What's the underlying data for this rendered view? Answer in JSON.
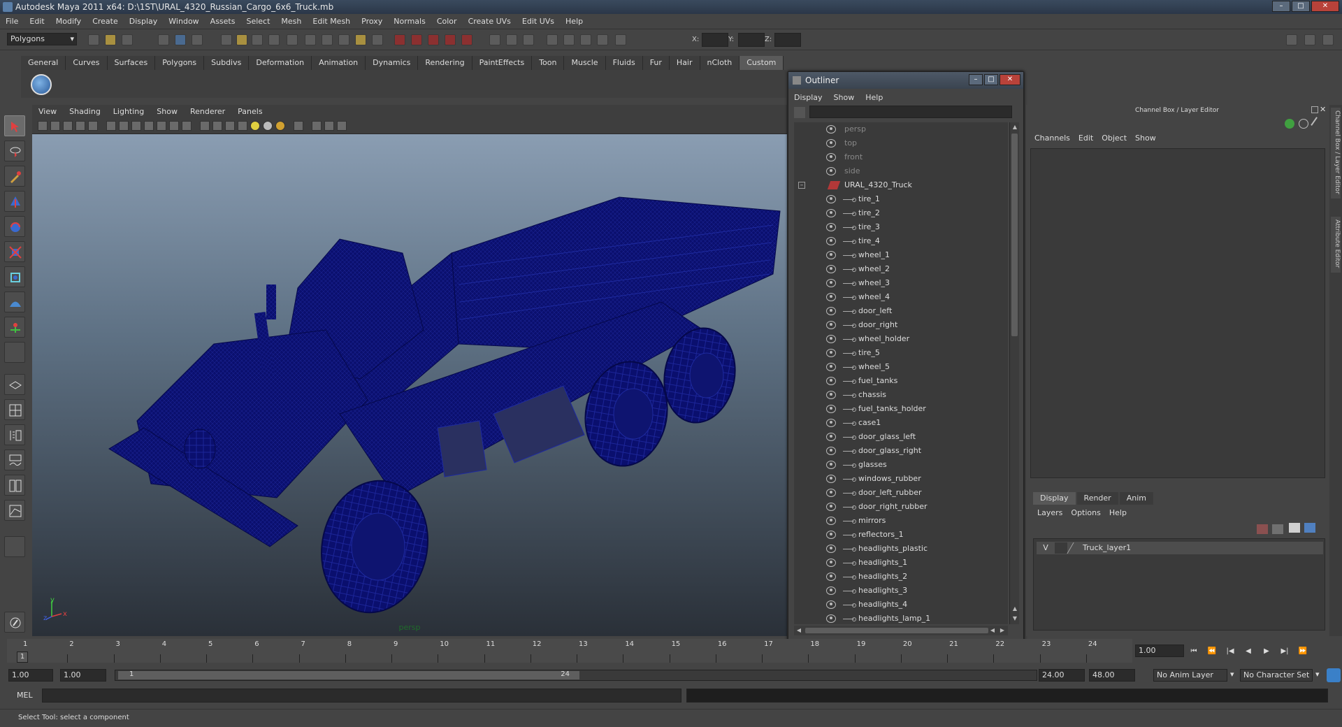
{
  "window": {
    "title": "Autodesk Maya 2011 x64: D:\\1ST\\URAL_4320_Russian_Cargo_6x6_Truck.mb",
    "minimize": "–",
    "maximize": "□",
    "close": "✕"
  },
  "menubar": [
    "File",
    "Edit",
    "Modify",
    "Create",
    "Display",
    "Window",
    "Assets",
    "Select",
    "Mesh",
    "Edit Mesh",
    "Proxy",
    "Normals",
    "Color",
    "Create UVs",
    "Edit UVs",
    "Help"
  ],
  "statusline": {
    "mode": "Polygons",
    "x_label": "X:",
    "y_label": "Y:",
    "z_label": "Z:"
  },
  "shelf": {
    "tabs": [
      "General",
      "Curves",
      "Surfaces",
      "Polygons",
      "Subdivs",
      "Deformation",
      "Animation",
      "Dynamics",
      "Rendering",
      "PaintEffects",
      "Toon",
      "Muscle",
      "Fluids",
      "Fur",
      "Hair",
      "nCloth",
      "Custom"
    ],
    "active": "Custom"
  },
  "viewport": {
    "menu": [
      "View",
      "Shading",
      "Lighting",
      "Show",
      "Renderer",
      "Panels"
    ],
    "camera": "persp",
    "axis_y": "y",
    "axis_x": "x",
    "axis_z": "z",
    "wire_color": "#0a0f6e"
  },
  "outliner": {
    "title": "Outliner",
    "menu": [
      "Display",
      "Show",
      "Help"
    ],
    "cameras": [
      "persp",
      "top",
      "front",
      "side"
    ],
    "group": "URAL_4320_Truck",
    "group_toggle": "–",
    "children": [
      "tire_1",
      "tire_2",
      "tire_3",
      "tire_4",
      "wheel_1",
      "wheel_2",
      "wheel_3",
      "wheel_4",
      "door_left",
      "door_right",
      "wheel_holder",
      "tire_5",
      "wheel_5",
      "fuel_tanks",
      "chassis",
      "fuel_tanks_holder",
      "case1",
      "door_glass_left",
      "door_glass_right",
      "glasses",
      "windows_rubber",
      "door_left_rubber",
      "door_right_rubber",
      "mirrors",
      "reflectors_1",
      "headlights_plastic",
      "headlights_1",
      "headlights_2",
      "headlights_3",
      "headlights_4",
      "headlights_lamp_1"
    ]
  },
  "channelbox": {
    "title": "Channel Box / Layer Editor",
    "menu": [
      "Channels",
      "Edit",
      "Object",
      "Show"
    ]
  },
  "layereditor": {
    "tabs": [
      "Display",
      "Render",
      "Anim"
    ],
    "active_tab": "Display",
    "menu": [
      "Layers",
      "Options",
      "Help"
    ],
    "layers": [
      {
        "visible": "V",
        "name": "Truck_layer1"
      }
    ]
  },
  "sidetabs": [
    "Channel Box / Layer Editor",
    "Attribute Editor"
  ],
  "timeslider": {
    "ticks": [
      "1",
      "2",
      "3",
      "4",
      "5",
      "6",
      "7",
      "8",
      "9",
      "10",
      "11",
      "12",
      "13",
      "14",
      "15",
      "16",
      "17",
      "18",
      "19",
      "20",
      "21",
      "22",
      "23",
      "24"
    ],
    "current": "1",
    "current_field": "1.00"
  },
  "playback": [
    "⏮",
    "⏪",
    "|◀",
    "◀",
    "▶",
    "▶|",
    "⏩"
  ],
  "rangebar": {
    "start": "1.00",
    "start2": "1.00",
    "thumb_start": "1",
    "thumb_end": "24",
    "end": "24.00",
    "end2": "48.00",
    "anim_layer": "No Anim Layer",
    "char_set": "No Character Set"
  },
  "cmdline": {
    "label": "MEL"
  },
  "helpline": "Select Tool: select a component"
}
